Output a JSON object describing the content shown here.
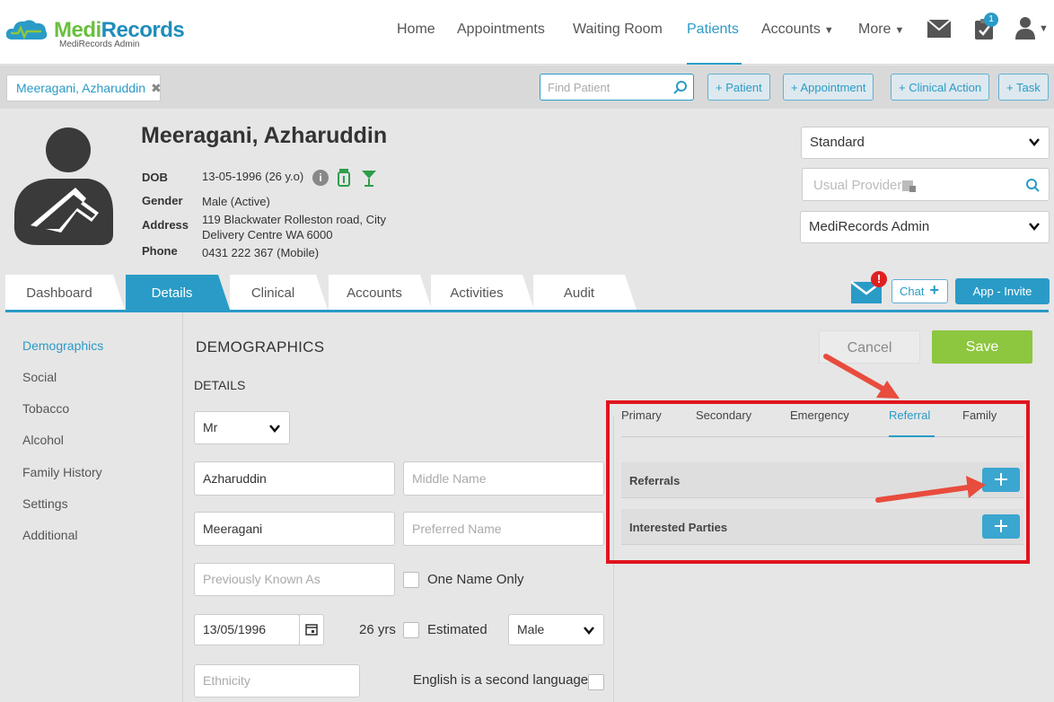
{
  "logo": {
    "brand_a": "Medi",
    "brand_b": "Records",
    "subtitle": "MediRecords Admin"
  },
  "nav": {
    "items": [
      "Home",
      "Appointments",
      "Waiting Room",
      "Patients",
      "Accounts",
      "More"
    ],
    "active": "Patients",
    "tasks_badge": "1"
  },
  "toolbar": {
    "patient_tab": "Meeragani, Azharuddin",
    "find_placeholder": "Find Patient",
    "buttons": [
      "+ Patient",
      "+ Appointment",
      "+ Clinical Action",
      "+ Task"
    ]
  },
  "patient": {
    "name": "Meeragani, Azharuddin",
    "labels": {
      "dob": "DOB",
      "gender": "Gender",
      "address": "Address",
      "phone": "Phone"
    },
    "dob": "13-05-1996 (26 y.o)",
    "gender": "Male (Active)",
    "address_line1": "119 Blackwater Rolleston road, City",
    "address_line2": "Delivery Centre WA 6000",
    "phone": "0431 222 367 (Mobile)"
  },
  "header_right": {
    "standard": "Standard",
    "usual_provider_placeholder": "Usual Provider",
    "admin": "MediRecords Admin"
  },
  "tabs": [
    "Dashboard",
    "Details",
    "Clinical",
    "Accounts",
    "Activities",
    "Audit"
  ],
  "active_tab": "Details",
  "tab_actions": {
    "chat": "Chat",
    "app_invite": "App - Invite",
    "alert": "!"
  },
  "sidenav": [
    "Demographics",
    "Social",
    "Tobacco",
    "Alcohol",
    "Family History",
    "Settings",
    "Additional"
  ],
  "sidenav_active": "Demographics",
  "section": {
    "title": "DEMOGRAPHICS",
    "subtitle": "DETAILS",
    "cancel": "Cancel",
    "save": "Save"
  },
  "form": {
    "title_value": "Mr",
    "first_name": "Azharuddin",
    "middle_name_placeholder": "Middle Name",
    "last_name": "Meeragani",
    "preferred_name_placeholder": "Preferred Name",
    "previously_known_placeholder": "Previously Known As",
    "one_name_only": "One Name Only",
    "dob_value": "13/05/1996",
    "age": "26 yrs",
    "estimated": "Estimated",
    "sex_value": "Male",
    "ethnicity_placeholder": "Ethnicity",
    "esl": "English is a second language"
  },
  "contacts": {
    "tabs": [
      "Primary",
      "Secondary",
      "Emergency",
      "Referral",
      "Family"
    ],
    "active": "Referral",
    "panels": [
      "Referrals",
      "Interested Parties"
    ]
  },
  "colors": {
    "accent": "#2a9bc7",
    "save": "#8dc63f",
    "highlight": "#e0141e"
  }
}
